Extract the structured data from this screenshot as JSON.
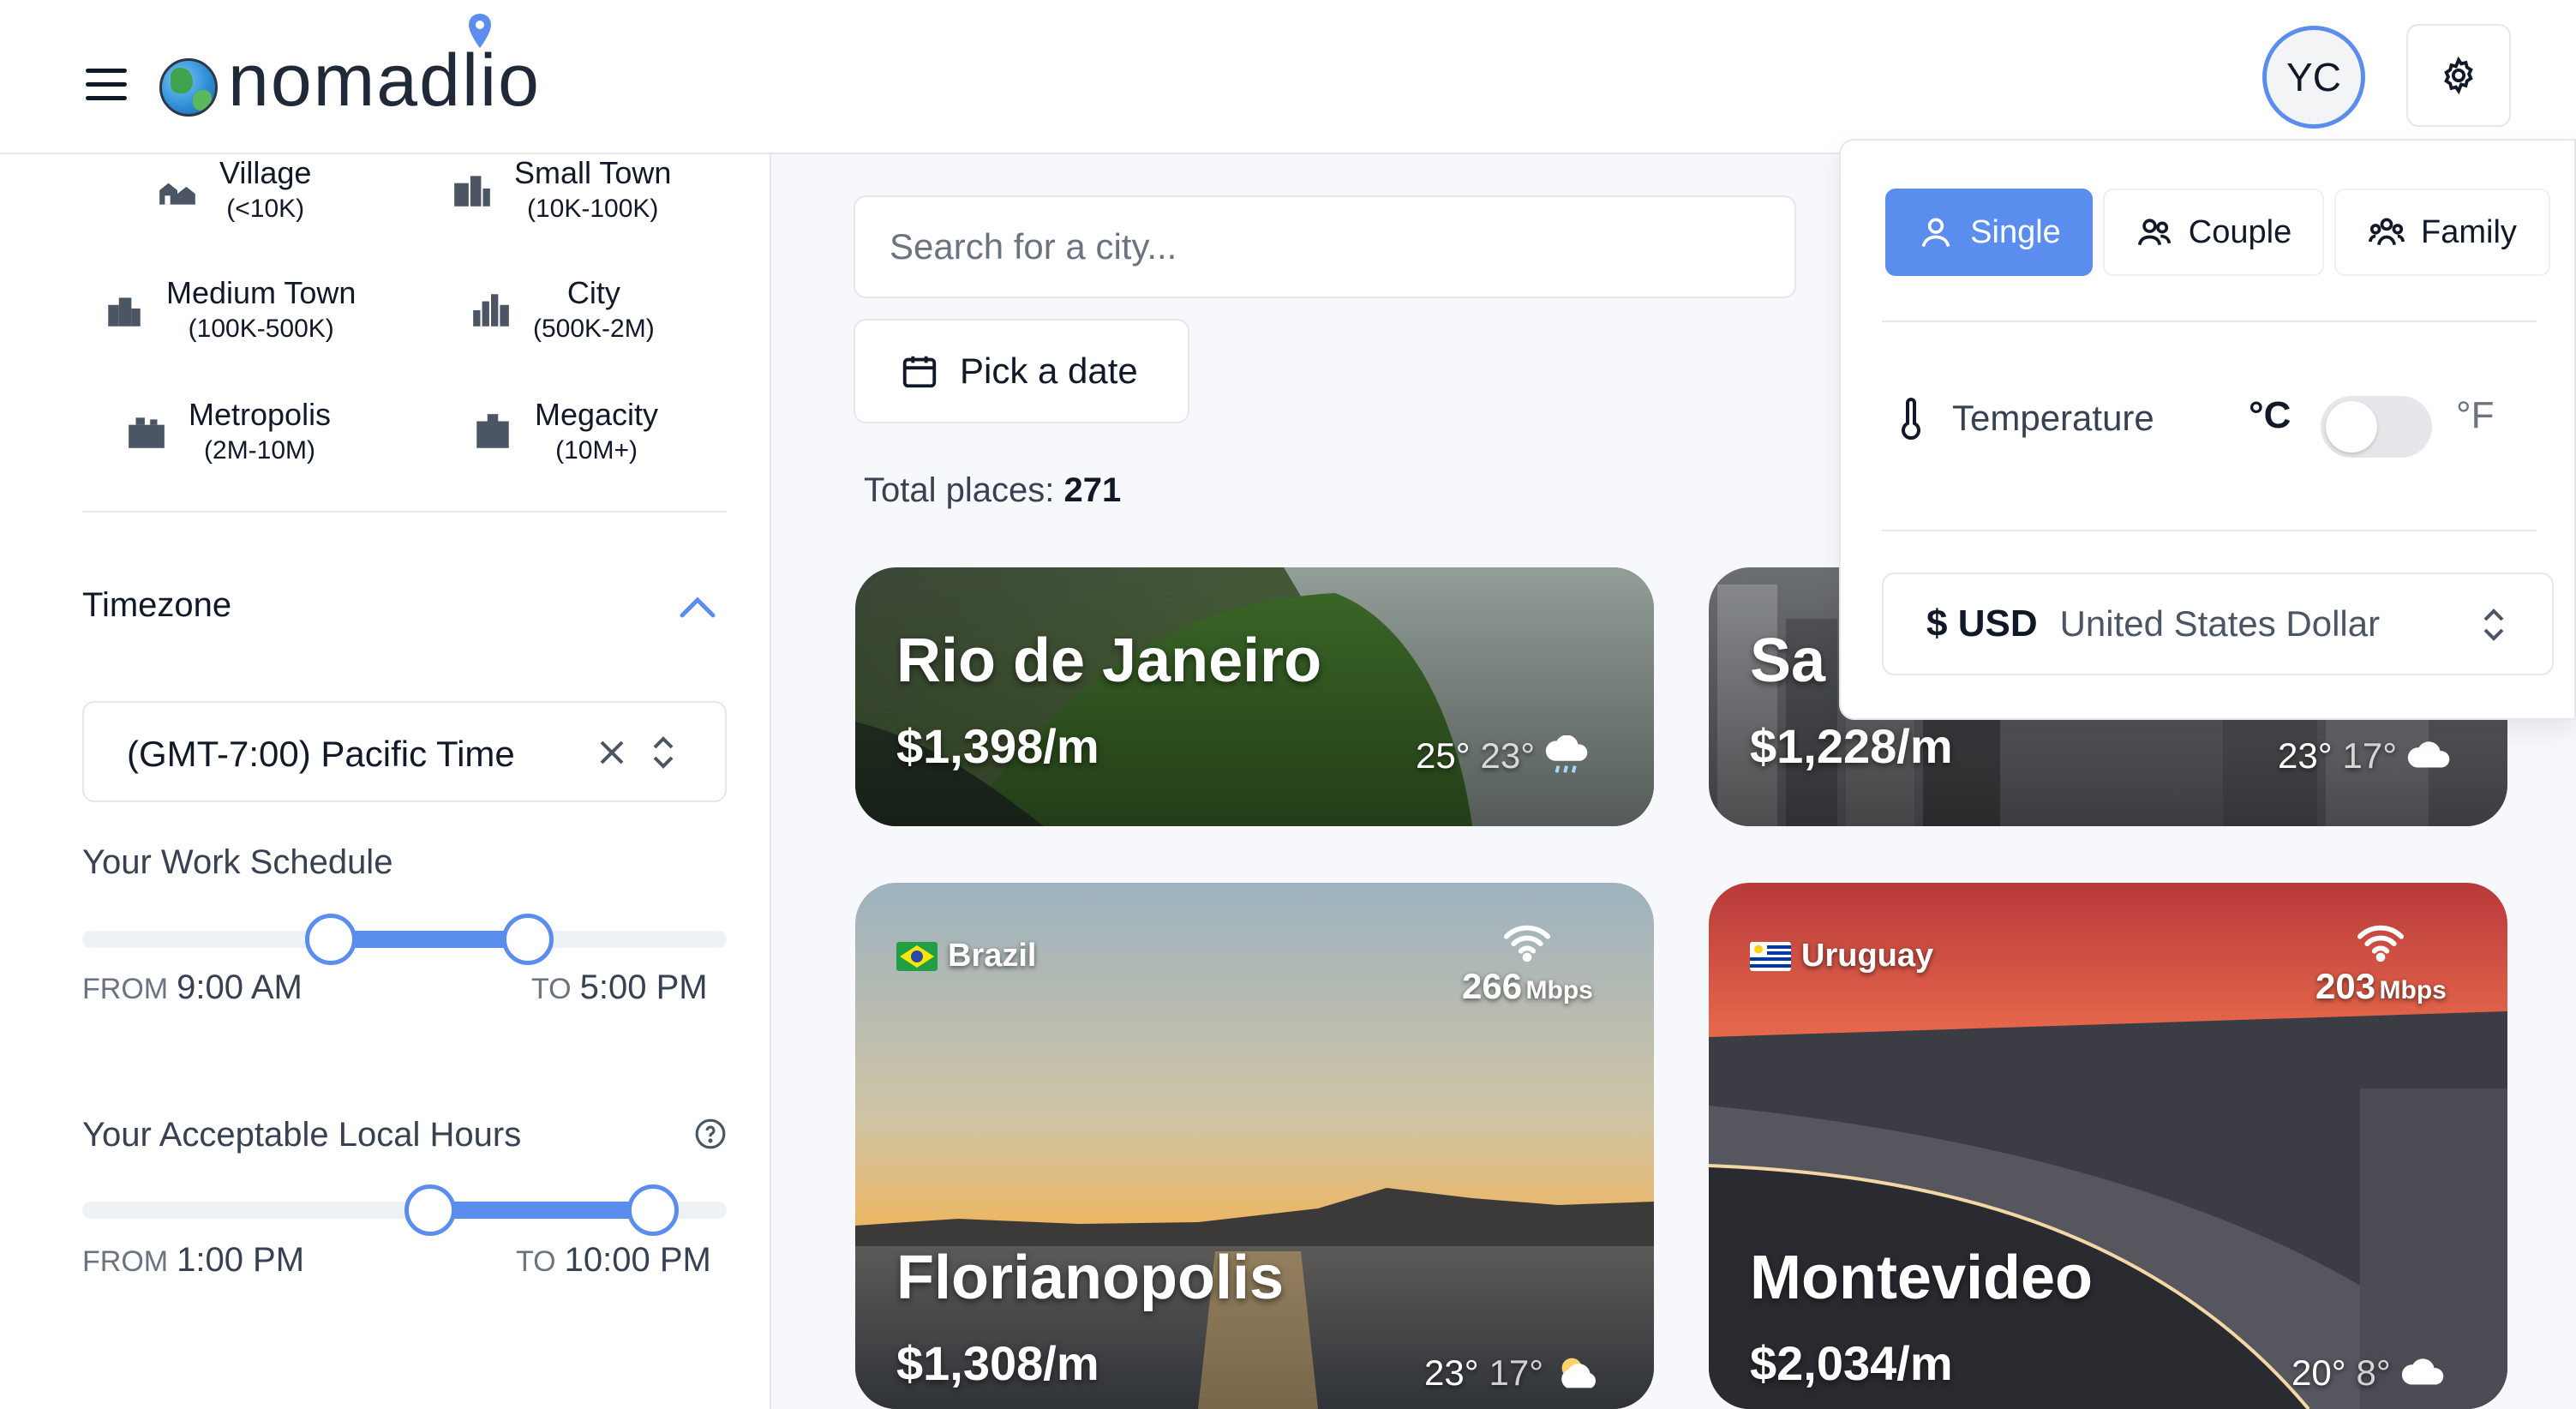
{
  "header": {
    "logo_text": "nomadlio",
    "avatar_initials": "YC"
  },
  "sidebar": {
    "city_sizes": [
      {
        "name": "Village",
        "range": "(<10K)",
        "icon": "village-icon"
      },
      {
        "name": "Small Town",
        "range": "(10K-100K)",
        "icon": "small-town-icon"
      },
      {
        "name": "Medium Town",
        "range": "(100K-500K)",
        "icon": "medium-town-icon"
      },
      {
        "name": "City",
        "range": "(500K-2M)",
        "icon": "city-icon"
      },
      {
        "name": "Metropolis",
        "range": "(2M-10M)",
        "icon": "metropolis-icon"
      },
      {
        "name": "Megacity",
        "range": "(10M+)",
        "icon": "megacity-icon"
      }
    ],
    "timezone": {
      "title": "Timezone",
      "value": "(GMT-7:00) Pacific Time"
    },
    "work_schedule": {
      "title": "Your Work Schedule",
      "from_prefix": "FROM",
      "from": "9:00 AM",
      "to_prefix": "TO",
      "to": "5:00 PM"
    },
    "local_hours": {
      "title": "Your Acceptable Local Hours",
      "from_prefix": "FROM",
      "from": "1:00 PM",
      "to_prefix": "TO",
      "to": "10:00 PM"
    }
  },
  "main": {
    "search_placeholder": "Search for a city...",
    "date_button": "Pick a date",
    "total_label": "Total places:",
    "total_count": "271",
    "cards": [
      {
        "name": "Rio de Janeiro",
        "cost": "$1,398/m",
        "high": "25°",
        "low": "23°",
        "weather": "rain-cloud-icon"
      },
      {
        "name": "Sa",
        "cost": "$1,228/m",
        "high": "23°",
        "low": "17°",
        "weather": "cloud-icon"
      },
      {
        "name": "Florianopolis",
        "cost": "$1,308/m",
        "country": "Brazil",
        "speed": "266",
        "unit": "Mbps",
        "high": "23°",
        "low": "17°",
        "weather": "sun-cloud-icon"
      },
      {
        "name": "Montevideo",
        "cost": "$2,034/m",
        "country": "Uruguay",
        "speed": "203",
        "unit": "Mbps",
        "high": "20°",
        "low": "8°",
        "weather": "cloud-icon"
      }
    ]
  },
  "settings": {
    "household": [
      {
        "label": "Single",
        "active": true
      },
      {
        "label": "Couple",
        "active": false
      },
      {
        "label": "Family",
        "active": false
      }
    ],
    "temperature_label": "Temperature",
    "unit_c": "°C",
    "unit_f": "°F",
    "currency_code": "$ USD",
    "currency_name": "United States Dollar"
  },
  "colors": {
    "accent": "#5b8def",
    "border": "#e5e7eb",
    "background": "#f6f8fb"
  }
}
